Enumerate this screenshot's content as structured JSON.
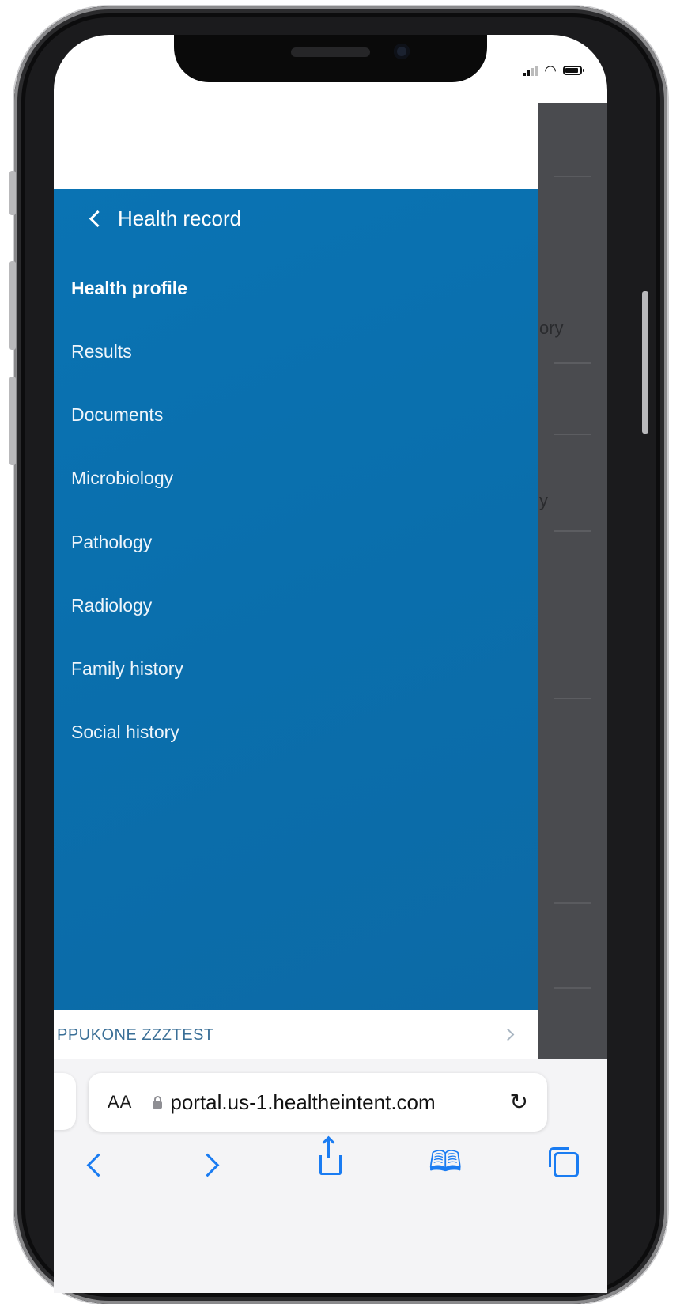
{
  "drawer": {
    "back_label": "Health record",
    "items": [
      {
        "label": "Health profile",
        "active": true
      },
      {
        "label": "Results"
      },
      {
        "label": "Documents"
      },
      {
        "label": "Microbiology"
      },
      {
        "label": "Pathology"
      },
      {
        "label": "Radiology"
      },
      {
        "label": "Family history"
      },
      {
        "label": "Social history"
      }
    ]
  },
  "background_page": {
    "visible_fragments": [
      "ory",
      "y"
    ]
  },
  "user_bar": {
    "name": "PPUKONE ZZZTEST"
  },
  "browser": {
    "text_size_label": "AA",
    "url": "portal.us-1.healtheintent.com",
    "toolbar_icons": [
      "back-icon",
      "forward-icon",
      "share-icon",
      "bookmarks-icon",
      "tabs-icon"
    ]
  },
  "colors": {
    "drawer_bg": "#0a6fad",
    "overlay_bg": "#4a4b4f",
    "toolbar_blue": "#1a7cf2"
  }
}
